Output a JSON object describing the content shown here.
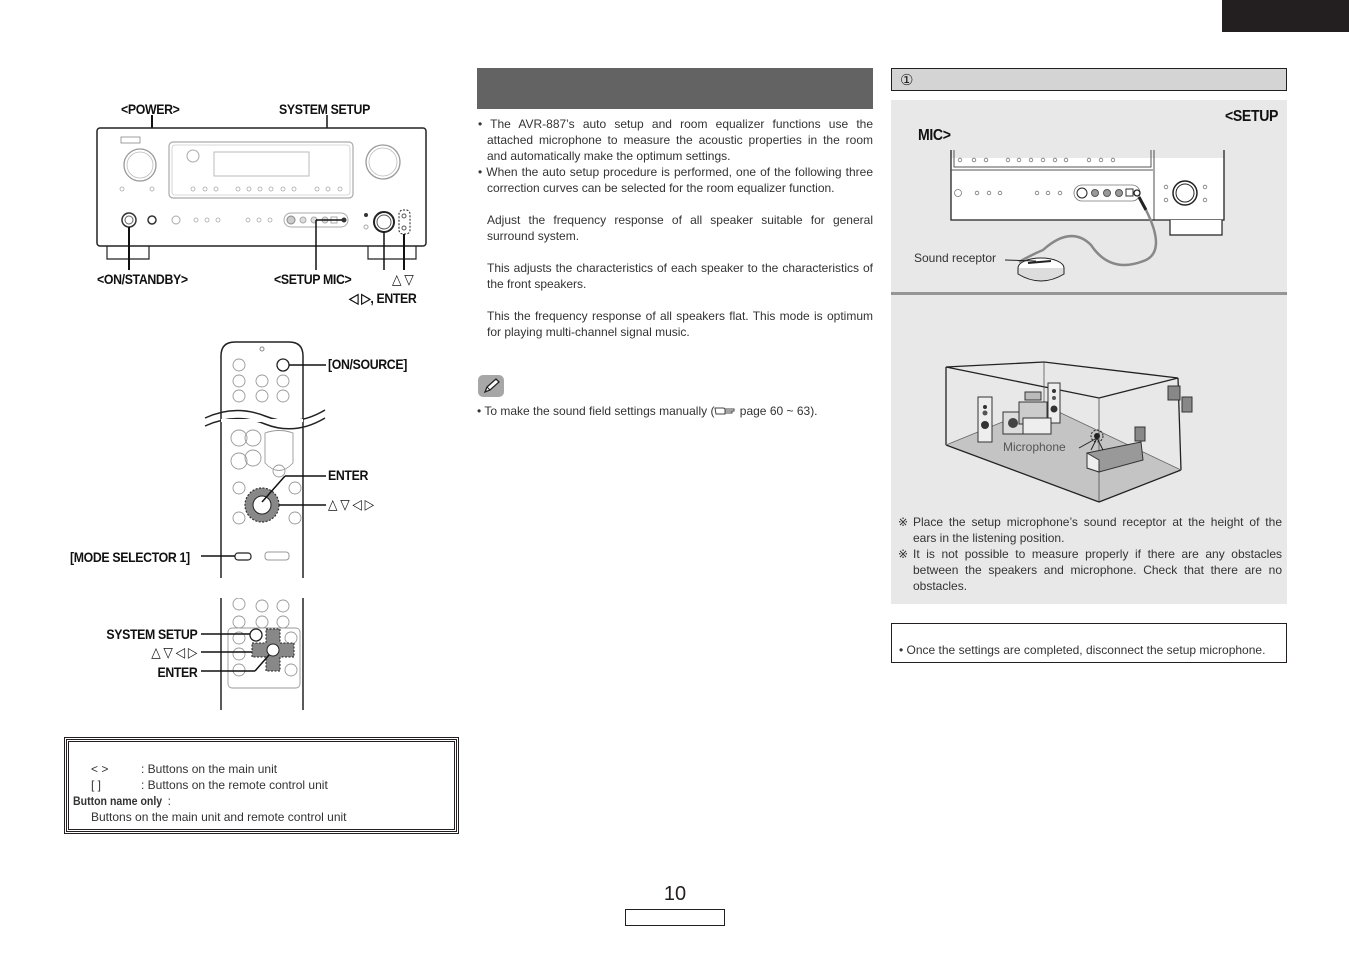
{
  "page": {
    "number": "10",
    "accent_color": "#231f20"
  },
  "main_unit_figure": {
    "labels": {
      "power": "<POWER>",
      "system_setup": "SYSTEM SETUP",
      "on_standby": "<ON/STANDBY>",
      "setup_mic": "<SETUP MIC>",
      "up_down": "△ ▽",
      "left_right_enter": "◁ ▷, ENTER"
    }
  },
  "remote_figure": {
    "labels": {
      "on_source": "[ON/SOURCE]",
      "enter": "ENTER",
      "arrows": "△ ▽ ◁ ▷",
      "mode_selector": "[MODE SELECTOR 1]",
      "system_setup": "SYSTEM SETUP",
      "arrows2": "△ ▽ ◁ ▷",
      "enter2": "ENTER"
    }
  },
  "legend": {
    "rows": [
      {
        "symbol": "<     >",
        "text": ": Buttons on the main unit"
      },
      {
        "symbol": "[     ]",
        "text": ": Buttons on the remote control unit"
      }
    ],
    "bold_label": "Button name only",
    "bold_suffix": " :",
    "last_line": "Buttons on the main unit and remote control unit"
  },
  "intro": {
    "bullets": [
      "• The AVR-887’s auto setup and room equalizer functions use the attached microphone to measure the acoustic properties in the room and automatically make the optimum settings.",
      "• When the auto setup procedure is performed, one of the following three correction curves can be selected for the room equalizer function."
    ],
    "curves": [
      "Adjust the frequency response of all speaker suitable for general surround system.",
      "This adjusts the characteristics of each speaker to the characteristics of the front speakers.",
      "This the frequency response of all speakers flat. This mode is optimum for playing multi-channel signal music."
    ],
    "note_icon": "pencil-icon",
    "note_text": "• To make the sound field settings manually (",
    "note_ref_icon": "hand-pointer-icon",
    "note_ref": " page 60 ~ 63)."
  },
  "step": {
    "number": "①",
    "mic_label_a": "<SETUP",
    "mic_label_b": "MIC>",
    "sound_receptor": "Sound receptor",
    "microphone": "Microphone",
    "cautions": [
      {
        "mark": "※",
        "text": "Place the setup microphone’s sound receptor at the height of the ears in the listening position."
      },
      {
        "mark": "※",
        "text": "It is not possible to measure properly if there are any obstacles between the speakers and microphone. Check that there are no obstacles."
      }
    ],
    "final_note": "• Once the settings are completed, disconnect the setup microphone."
  }
}
